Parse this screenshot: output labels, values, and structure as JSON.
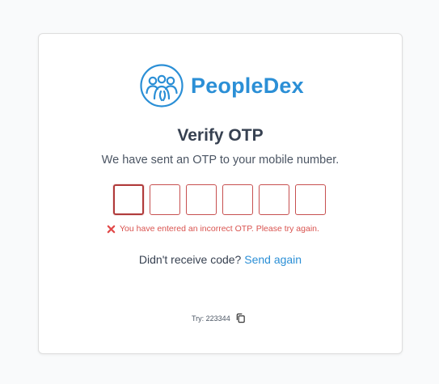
{
  "brand": {
    "name": "PeopleDex",
    "logo_icon": "people-group-icon",
    "color": "#2b8fd6"
  },
  "heading": "Verify OTP",
  "subheading": "We have sent an OTP to your mobile number.",
  "otp": {
    "digits": 6,
    "values": [
      "",
      "",
      "",
      "",
      "",
      ""
    ]
  },
  "error": {
    "icon": "error-x-icon",
    "message": "You have entered an incorrect OTP. Please try again.",
    "color": "#d9534f"
  },
  "resend": {
    "prompt": "Didn't receive code?",
    "link_label": "Send again"
  },
  "hint": {
    "text": "Try: 223344",
    "copy_icon": "copy-icon"
  }
}
